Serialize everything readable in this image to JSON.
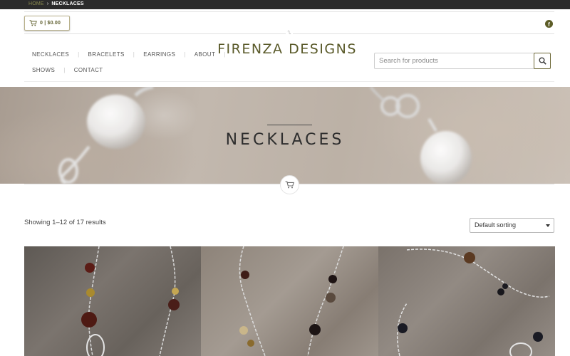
{
  "breadcrumb": {
    "home": "HOME",
    "separator": "›",
    "current": "NECKLACES"
  },
  "cart": {
    "summary": "0 | $0.00"
  },
  "social": {
    "facebook_icon": "f"
  },
  "site": {
    "title": "FIRENZA DESIGNS"
  },
  "nav": {
    "row1": [
      "NECKLACES",
      "BRACELETS",
      "EARRINGS",
      "ABOUT"
    ],
    "row2": [
      "SHOWS",
      "CONTACT"
    ],
    "separator": "|"
  },
  "search": {
    "placeholder": "Search for products"
  },
  "hero": {
    "title": "NECKLACES"
  },
  "listing": {
    "results_text": "Showing 1–12 of 17 results",
    "sort_selected": "Default sorting"
  },
  "colors": {
    "accent": "#5a5a2a",
    "topbar": "#2b2b2b",
    "breadcrumb_home": "#8a8a4e"
  }
}
